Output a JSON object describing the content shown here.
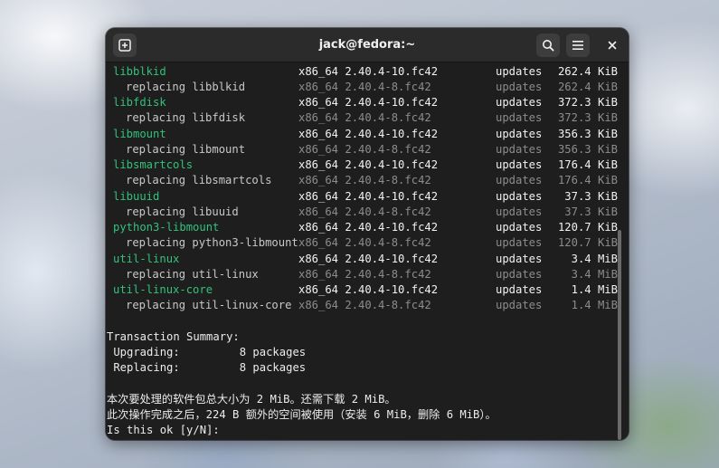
{
  "window": {
    "title": "jack@fedora:~"
  },
  "icons": {
    "new_tab": "new-tab-icon",
    "search": "search-icon",
    "menu": "hamburger-menu-icon",
    "close": "close-icon"
  },
  "packages": [
    {
      "name": "libblkid",
      "arch_version": "x86_64 2.40.4-10.fc42",
      "repo": "updates",
      "size": "262.4 KiB",
      "replacing": "replacing libblkid",
      "old_arch_version": "x86_64 2.40.4-8.fc42",
      "old_repo": "updates",
      "old_size": "262.4 KiB"
    },
    {
      "name": "libfdisk",
      "arch_version": "x86_64 2.40.4-10.fc42",
      "repo": "updates",
      "size": "372.3 KiB",
      "replacing": "replacing libfdisk",
      "old_arch_version": "x86_64 2.40.4-8.fc42",
      "old_repo": "updates",
      "old_size": "372.3 KiB"
    },
    {
      "name": "libmount",
      "arch_version": "x86_64 2.40.4-10.fc42",
      "repo": "updates",
      "size": "356.3 KiB",
      "replacing": "replacing libmount",
      "old_arch_version": "x86_64 2.40.4-8.fc42",
      "old_repo": "updates",
      "old_size": "356.3 KiB"
    },
    {
      "name": "libsmartcols",
      "arch_version": "x86_64 2.40.4-10.fc42",
      "repo": "updates",
      "size": "176.4 KiB",
      "replacing": "replacing libsmartcols",
      "old_arch_version": "x86_64 2.40.4-8.fc42",
      "old_repo": "updates",
      "old_size": "176.4 KiB"
    },
    {
      "name": "libuuid",
      "arch_version": "x86_64 2.40.4-10.fc42",
      "repo": "updates",
      "size": "37.3 KiB",
      "replacing": "replacing libuuid",
      "old_arch_version": "x86_64 2.40.4-8.fc42",
      "old_repo": "updates",
      "old_size": "37.3 KiB"
    },
    {
      "name": "python3-libmount",
      "arch_version": "x86_64 2.40.4-10.fc42",
      "repo": "updates",
      "size": "120.7 KiB",
      "replacing": "replacing python3-libmount",
      "old_arch_version": "x86_64 2.40.4-8.fc42",
      "old_repo": "updates",
      "old_size": "120.7 KiB"
    },
    {
      "name": "util-linux",
      "arch_version": "x86_64 2.40.4-10.fc42",
      "repo": "updates",
      "size": "3.4 MiB",
      "replacing": "replacing util-linux",
      "old_arch_version": "x86_64 2.40.4-8.fc42",
      "old_repo": "updates",
      "old_size": "3.4 MiB"
    },
    {
      "name": "util-linux-core",
      "arch_version": "x86_64 2.40.4-10.fc42",
      "repo": "updates",
      "size": "1.4 MiB",
      "replacing": "replacing util-linux-core",
      "old_arch_version": "x86_64 2.40.4-8.fc42",
      "old_repo": "updates",
      "old_size": "1.4 MiB"
    }
  ],
  "summary": {
    "heading": "Transaction Summary:",
    "upgrading": " Upgrading:         8 packages",
    "replacing": " Replacing:         8 packages"
  },
  "messages": {
    "line1": "本次要处理的软件包总大小为 2 MiB。还需下载 2 MiB。",
    "line2": "此次操作完成之后，224 B 额外的空间被使用（安装 6 MiB，删除 6 MiB）。",
    "prompt": "Is this ok [y/N]:"
  },
  "colors": {
    "package_name": "#33c17b",
    "terminal_bg": "#1e1e1e",
    "titlebar_bg": "#2b2b2b"
  }
}
